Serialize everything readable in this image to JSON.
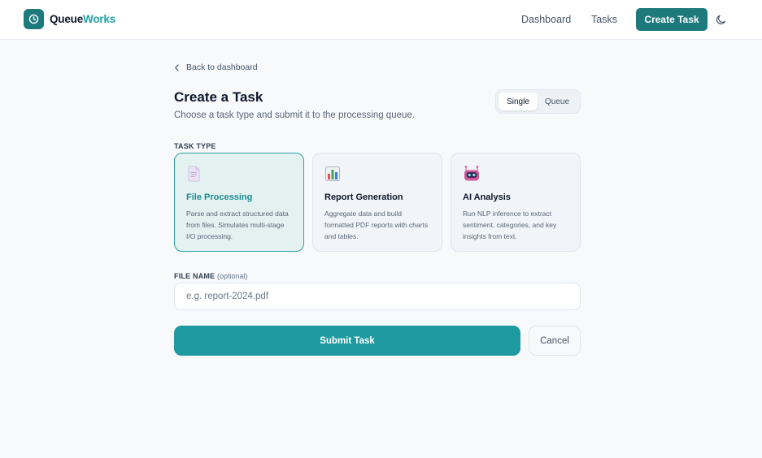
{
  "header": {
    "brand_part1": "Queue",
    "brand_part2": "Works",
    "logo_icon": "clock-icon",
    "nav": {
      "dashboard": "Dashboard",
      "tasks": "Tasks",
      "create_task": "Create Task"
    },
    "theme_icon": "moon-icon"
  },
  "back_link": "Back to dashboard",
  "page": {
    "title": "Create a Task",
    "subtitle": "Choose a task type and submit it to the processing queue."
  },
  "mode_toggle": {
    "options": [
      "Single",
      "Queue"
    ],
    "selected": "Single"
  },
  "task_type": {
    "label": "TASK TYPE",
    "selected": "File Processing",
    "cards": [
      {
        "title": "File Processing",
        "description": "Parse and extract structured data from files. Simulates multi-stage I/O processing.",
        "icon": "document-icon"
      },
      {
        "title": "Report Generation",
        "description": "Aggregate data and build formatted PDF reports with charts and tables.",
        "icon": "bar-chart-icon"
      },
      {
        "title": "AI Analysis",
        "description": "Run NLP inference to extract sentiment, categories, and key insights from text.",
        "icon": "robot-icon"
      }
    ]
  },
  "file_name": {
    "label": "FILE NAME",
    "optional_note": "(optional)",
    "value": "",
    "placeholder": "e.g. report-2024.pdf"
  },
  "actions": {
    "submit": "Submit Task",
    "cancel": "Cancel"
  },
  "colors": {
    "accent": "#1d7a7c",
    "accent_light": "#22a3a8",
    "submit": "#1e9aa0",
    "selected_card_bg": "#e3f1f1"
  }
}
